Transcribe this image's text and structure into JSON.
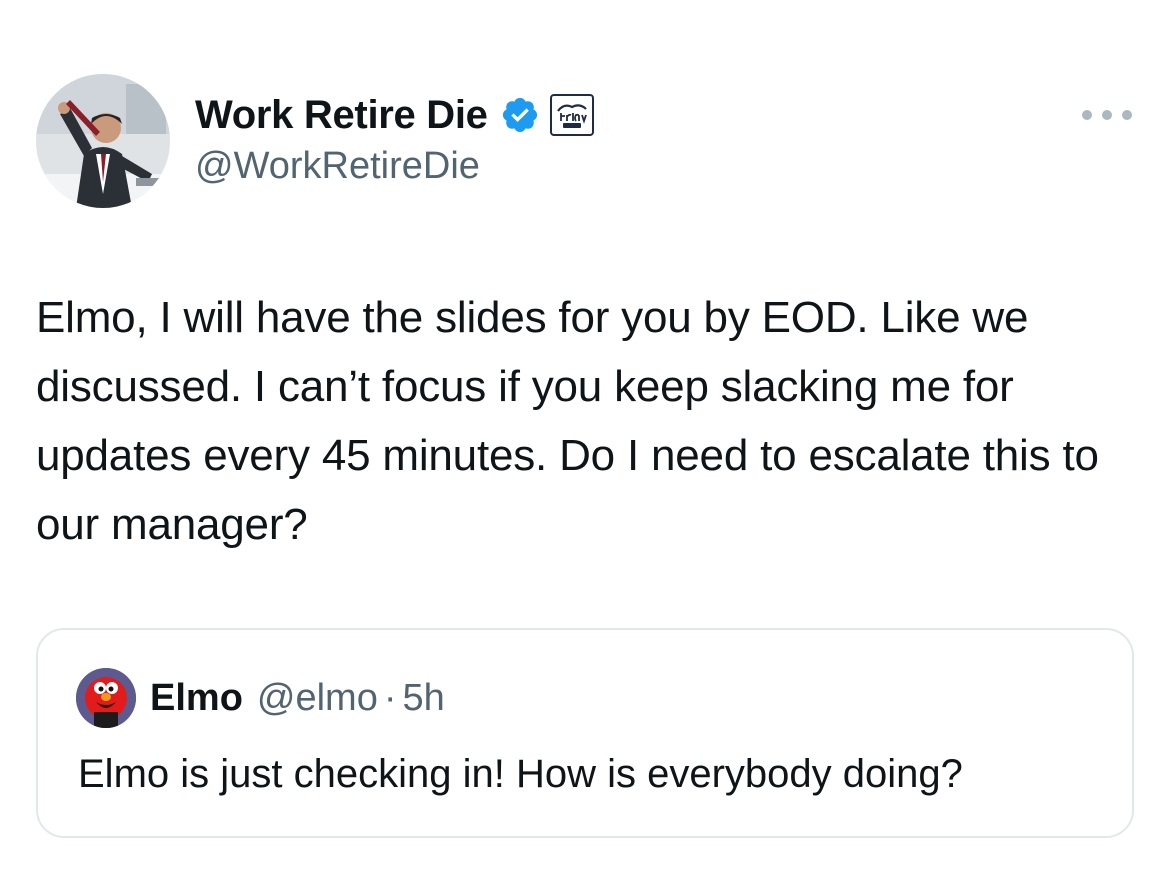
{
  "author": {
    "display_name": "Work Retire Die",
    "handle": "@WorkRetireDie",
    "verified_icon": "verified-badge-icon",
    "affiliation_icon": "friday-beers-badge-icon"
  },
  "menu": {
    "icon": "more-options-icon"
  },
  "tweet": {
    "text": "Elmo, I will have the slides for you by EOD. Like we discussed. I can’t focus if you keep slacking me for updates every 45 minutes. Do I need to escalate this to our manager?"
  },
  "quoted": {
    "display_name": "Elmo",
    "handle": "@elmo",
    "separator": "·",
    "time": "5h",
    "text": "Elmo is just checking in! How is everybody doing?"
  },
  "colors": {
    "verified_blue": "#1d9bf0",
    "secondary_text": "#536471",
    "border": "#e1e8ed"
  }
}
